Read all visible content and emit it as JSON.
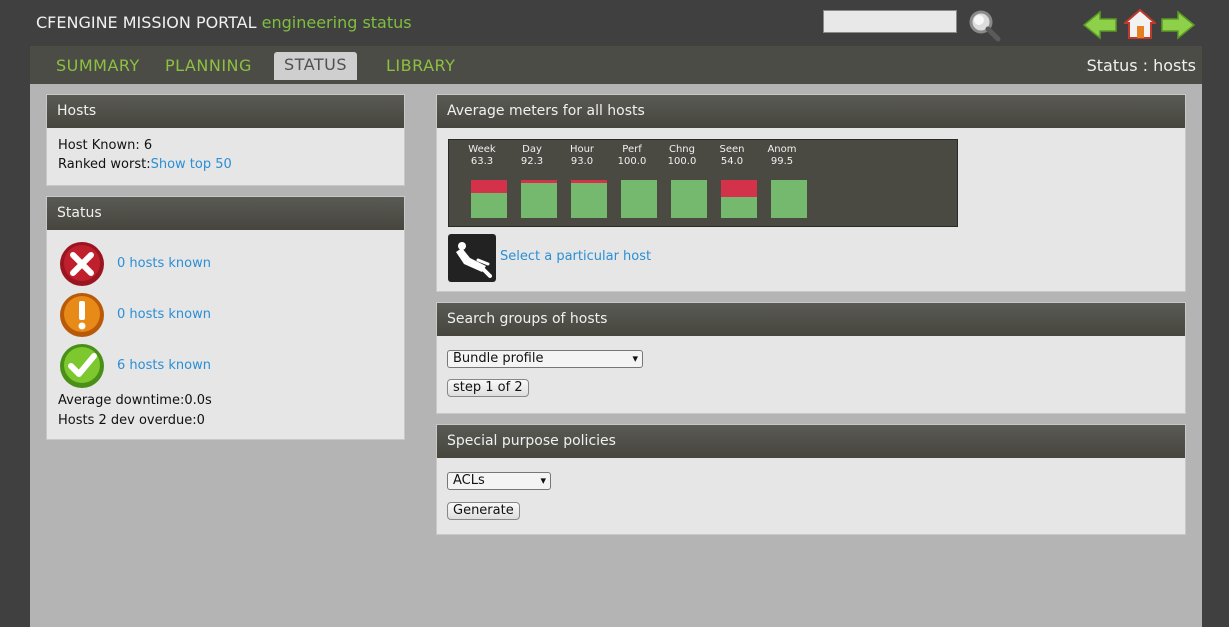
{
  "header": {
    "brand": "CFENGINE MISSION PORTAL",
    "subtitle": "engineering status",
    "search": {
      "value": ""
    },
    "icons": [
      "search-icon",
      "back-arrow-icon",
      "home-icon",
      "forward-arrow-icon"
    ]
  },
  "nav": {
    "tabs": [
      {
        "label": "SUMMARY"
      },
      {
        "label": "PLANNING"
      },
      {
        "label": "STATUS",
        "active": true
      },
      {
        "label": "LIBRARY"
      }
    ],
    "breadcrumb": "Status : hosts"
  },
  "hosts_panel": {
    "title": "Hosts",
    "known_label": "Host Known: ",
    "known_value": "6",
    "ranked_label": "Ranked worst:",
    "ranked_link": "Show top 50"
  },
  "status_panel": {
    "title": "Status",
    "rows": [
      {
        "icon": "red-x-icon",
        "label": "0 hosts known"
      },
      {
        "icon": "orange-warning-icon",
        "label": "0 hosts known"
      },
      {
        "icon": "green-check-icon",
        "label": "6 hosts known"
      }
    ],
    "downtime": "Average downtime:0.0s",
    "overdue": "Hosts 2 dev overdue:0"
  },
  "meters_panel": {
    "title": "Average meters for all hosts",
    "meters": [
      {
        "name": "Week",
        "value": "63.3",
        "red_fraction": 0.35
      },
      {
        "name": "Day",
        "value": "92.3",
        "red_fraction": 0.08
      },
      {
        "name": "Hour",
        "value": "93.0",
        "red_fraction": 0.07
      },
      {
        "name": "Perf",
        "value": "100.0",
        "red_fraction": 0.0
      },
      {
        "name": "Chng",
        "value": "100.0",
        "red_fraction": 0.0
      },
      {
        "name": "Seen",
        "value": "54.0",
        "red_fraction": 0.46
      },
      {
        "name": "Anom",
        "value": "99.5",
        "red_fraction": 0.0
      }
    ],
    "select_host_link": "Select a particular host",
    "colors": {
      "ok": "#74b96e",
      "bad": "#d4324a"
    }
  },
  "search_groups_panel": {
    "title": "Search groups of hosts",
    "select_value": "Bundle profile",
    "step_button": "step 1 of 2"
  },
  "special_panel": {
    "title": "Special purpose policies",
    "select_value": "ACLs",
    "generate_button": "Generate"
  }
}
